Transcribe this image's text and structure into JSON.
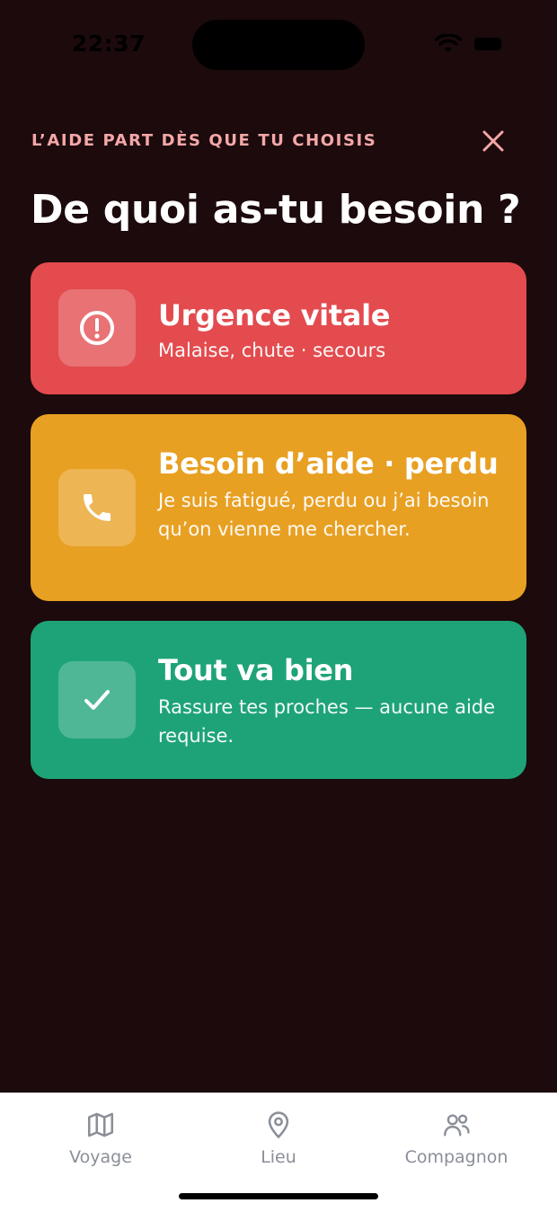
{
  "status_bar": {
    "time": "22:37"
  },
  "header": {
    "eyebrow": "L’AIDE PART DÈS QUE TU CHOISIS",
    "title": "De quoi as-tu besoin ?"
  },
  "options": [
    {
      "title": "Urgence vitale",
      "subtitle": "Malaise, chute · secours",
      "icon": "alert-circle-icon",
      "color": "#e34b4e"
    },
    {
      "title": "Besoin d’aide · perdu",
      "subtitle": "Je suis fatigué, perdu ou j’ai besoin qu’on vienne me chercher.",
      "icon": "phone-icon",
      "color": "#e8a023"
    },
    {
      "title": "Tout va bien",
      "subtitle": "Rassure tes proches — aucune aide requise.",
      "icon": "check-icon",
      "color": "#1ea378"
    }
  ],
  "tabbar": {
    "items": [
      {
        "label": "Voyage",
        "icon": "map-icon"
      },
      {
        "label": "Lieu",
        "icon": "map-pin-icon"
      },
      {
        "label": "Compagnon",
        "icon": "users-icon"
      }
    ]
  }
}
